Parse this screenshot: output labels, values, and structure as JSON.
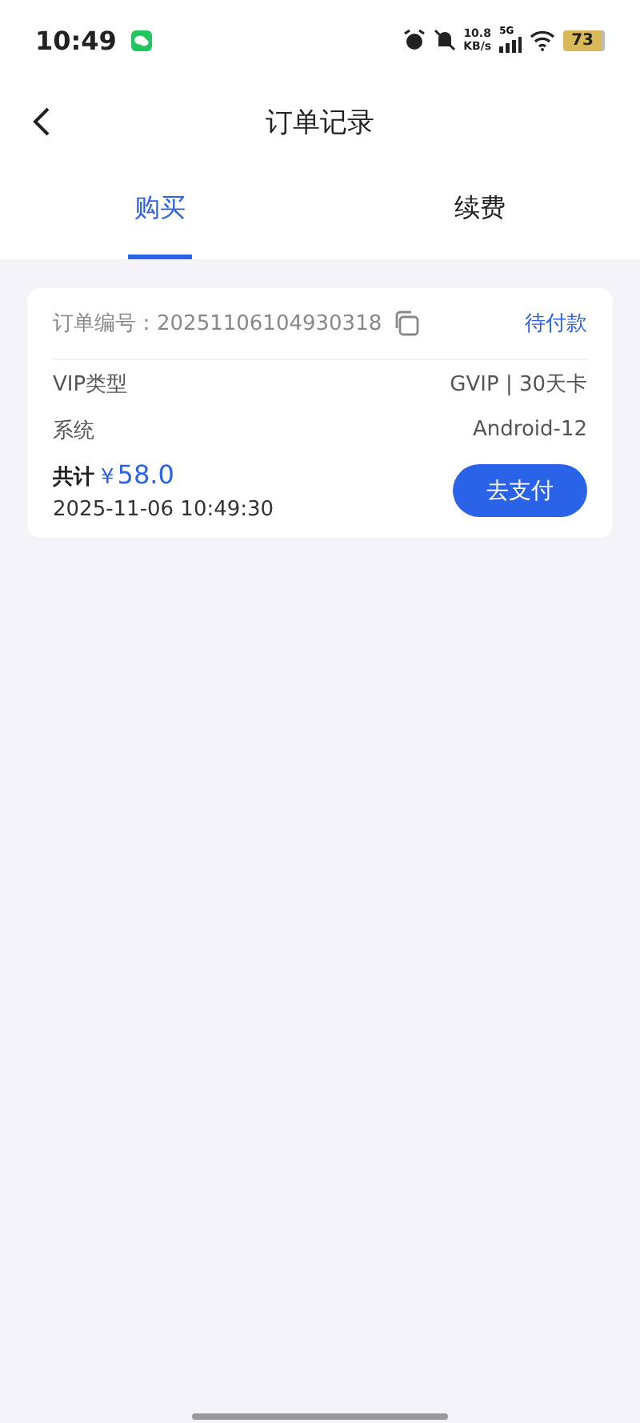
{
  "status_bar": {
    "time": "10:49",
    "net_speed": "10.8",
    "net_unit": "KB/s",
    "network": "5G",
    "battery": "73"
  },
  "header": {
    "title": "订单记录"
  },
  "tabs": [
    {
      "label": "购买",
      "selected": true
    },
    {
      "label": "续费",
      "selected": false
    }
  ],
  "orders": [
    {
      "number_label": "订单编号：",
      "number": "20251106104930318",
      "status": "待付款",
      "rows": [
        {
          "label": "VIP类型",
          "value": "GVIP | 30天卡"
        },
        {
          "label": "系统",
          "value": "Android-12"
        }
      ],
      "total_label": "共计",
      "currency": "¥",
      "amount": "58.0",
      "date": "2025-11-06 10:49:30",
      "button": "去支付"
    }
  ]
}
